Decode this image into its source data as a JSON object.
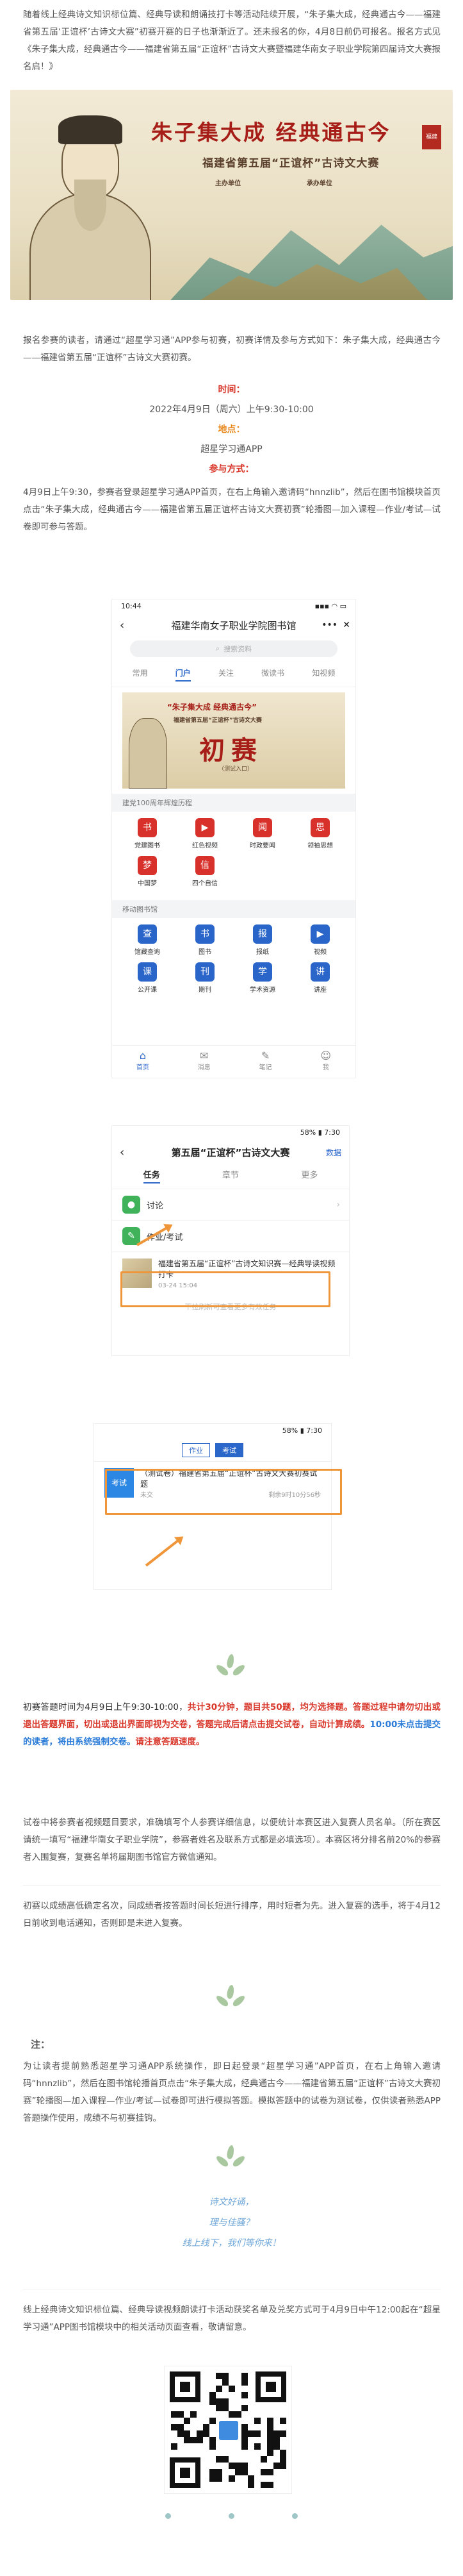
{
  "intro_paragraph": "随着线上经典诗文知识标位篇、经典导读和朗诵技打卡等活动陆续开展，“朱子集大成，经典通古今——福建省第五届‘正谊杯’古诗文大赛”初赛开赛的日子也渐渐近了。还未报名的你，4月8日前仍可报名。报名方式见《朱子集大成，经典通古今——福建省第五届“正谊杯”古诗文大赛暨福建华南女子职业学院第四届诗文大赛报名启！》",
  "banner": {
    "title": "朱子集大成 经典通古今",
    "subtitle": "福建省第五届“正谊杯”古诗文大赛",
    "org_left_title": "主办单位",
    "org_right_title": "承办单位",
    "seal": "福建"
  },
  "notice_paragraph": "报名参赛的读者，请通过“超星学习通”APP参与初赛，初赛详情及参与方式如下：朱子集大成，经典通古今——福建省第五届“正谊杯”古诗文大赛初赛。",
  "time_label": "时间：",
  "time_value": "2022年4月9日（周六）上午9:30-10:00",
  "place_label": "地点：",
  "place_value": "超星学习通APP",
  "method_label": "参与方式：",
  "method_paragraph": "4月9日上午9:30，参赛者登录超星学习通APP首页，在右上角输入邀请码“hnnzlib”，然后在图书馆模块首页点击“朱子集大成，经典通古今——福建省第五届正谊杯古诗文大赛初赛”轮播图—加入课程—作业/考试—试卷即可参与答题。",
  "phone1": {
    "time": "10:44",
    "signal": "▪▪▪ ◠ ▭",
    "header": "福建华南女子职业学院图书馆",
    "more": "•••",
    "close": "✕",
    "search_placeholder": "搜索资料",
    "tabs": [
      "常用",
      "门户",
      "关注",
      "微读书",
      "知视频"
    ],
    "banner_t1": "“朱子集大成 经典通古今”",
    "banner_t2": "福建省第五届“正谊杯”古诗文大赛",
    "banner_t3": "初赛",
    "banner_t4": "（测试入口）",
    "section1": "建党100周年辉煌历程",
    "grid1": [
      {
        "label": "党建图书",
        "icon": "书"
      },
      {
        "label": "红色视频",
        "icon": "▶"
      },
      {
        "label": "时政要闻",
        "icon": "闻"
      },
      {
        "label": "领袖思想",
        "icon": "思"
      },
      {
        "label": "中国梦",
        "icon": "梦"
      },
      {
        "label": "四个自信",
        "icon": "信"
      }
    ],
    "section2": "移动图书馆",
    "grid2": [
      {
        "label": "馆藏查询",
        "icon": "查"
      },
      {
        "label": "图书",
        "icon": "书"
      },
      {
        "label": "报纸",
        "icon": "报"
      },
      {
        "label": "视频",
        "icon": "▶"
      },
      {
        "label": "公开课",
        "icon": "课"
      },
      {
        "label": "期刊",
        "icon": "刊"
      },
      {
        "label": "学术资源",
        "icon": "学"
      },
      {
        "label": "讲座",
        "icon": "讲"
      }
    ],
    "bottom_nav": [
      {
        "label": "首页",
        "icon": "⌂"
      },
      {
        "label": "消息",
        "icon": "✉"
      },
      {
        "label": "笔记",
        "icon": "✎"
      },
      {
        "label": "我",
        "icon": "☺"
      }
    ]
  },
  "phone2": {
    "time": "",
    "status_right": "58% ▮ 7:30",
    "header": "第五届“正谊杯”古诗文大赛",
    "edit": "数据",
    "tabs": [
      "任务",
      "章节",
      "更多"
    ],
    "rows": [
      {
        "label": "讨论",
        "icon": "●"
      },
      {
        "label": "作业/考试",
        "icon": "✎"
      }
    ],
    "notice_title": "福建省第五届“正谊杯”古诗文知识赛—经典导读视频打卡",
    "notice_date": "03-24 15:04",
    "faint": "下拉刷新可查看更多有效任务"
  },
  "phone3": {
    "status_right": "58% ▮ 7:30",
    "tabs": [
      "作业",
      "考试"
    ],
    "exam_icon": "考试",
    "exam_title": "（测试卷）福建省第五届“正谊杯”古诗文大赛初赛试题",
    "exam_status": "未交",
    "exam_time": "剩余9时10分56秒"
  },
  "rule_paragraph_parts": [
    "初赛答题时间为4月9日上午9:30-10:00，",
    "共计30分钟，题目共50题，均为选择题。",
    "答题过程中请勿切出或退出答题界面，切出或退出界面即视为交卷，答题完成后请点击提交试卷，自动计算成绩。",
    "10:00未点击提交的读者，将由系统强制交卷。",
    "请注意答题速度。"
  ],
  "rule_paragraph2": "试卷中将参赛者视频题目要求，准确填写个人参赛详细信息，以便统计本赛区进入复赛人员名单。（所在赛区请统一填写“福建华南女子职业学院”，参赛者姓名及联系方式都是必填选项）。本赛区将分排名前20%的参赛者入围复赛，复赛名单将届期图书馆官方微信通知。",
  "rule_paragraph3": "初赛以成绩高低确定名次，同成绩者按答题时间长短进行排序，用时短者为先。进入复赛的选手，将于4月12日前收到电话通知，否则即是未进入复赛。",
  "note_head": "注：",
  "note_paragraph": "为让读者提前熟悉超星学习通APP系统操作，即日起登录“超星学习通”APP首页，在右上角输入邀请码“hnnzlib”，然后在图书馆轮播首页点击“朱子集大成，经典通古今——福建省第五届“正谊杯”古诗文大赛初赛”轮播图—加入课程—作业/考试—试卷即可进行模拟答题。模拟答题中的试卷为测试卷，仅供读者熟悉APP答题操作使用，成绩不与初赛挂钩。",
  "poem": [
    "诗文好诵，",
    "理与佳骚？",
    "线上线下，我们等你来！"
  ],
  "closing_paragraph": "线上经典诗文知识标位篇、经典导读视频朗读打卡活动获奖名单及兑奖方式可于4月9日中午12:00起在“超星学习通”APP图书馆模块中的相关活动页面查看，敬请留意。"
}
